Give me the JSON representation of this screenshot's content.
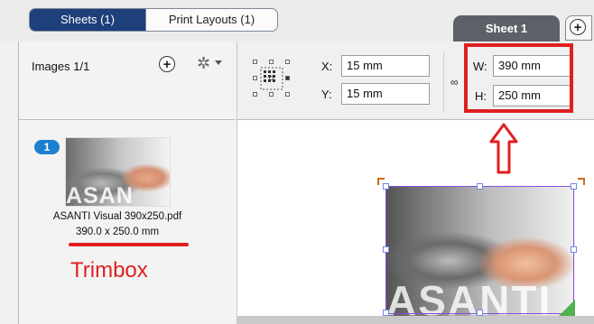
{
  "tabs": {
    "sheets": "Sheets (1)",
    "print_layouts": "Print Layouts (1)",
    "sheet_tab": "Sheet 1",
    "add_tab": "+"
  },
  "images_panel": {
    "count_label": "Images 1/1",
    "add_label": "+",
    "gear_symbol": "✲"
  },
  "image_item": {
    "badge": "1",
    "thumbnail_text": "ASAN",
    "filename": "ASANTI Visual 390x250.pdf",
    "dimensions": "390.0 x 250.0 mm"
  },
  "annotation": {
    "trimbox_label": "Trimbox",
    "color": "#e01f1f"
  },
  "properties": {
    "x_label": "X:",
    "x_value": "15 mm",
    "y_label": "Y:",
    "y_value": "15 mm",
    "w_label": "W:",
    "w_value": "390 mm",
    "h_label": "H:",
    "h_value": "250 mm",
    "link_symbol": "∞"
  },
  "canvas": {
    "photo_text": "ASANTI"
  },
  "colors": {
    "active_tab": "#1d3f7a",
    "sheet_tab": "#5c6168",
    "badge": "#1d7fd0",
    "selection": "#8a4fd8"
  }
}
